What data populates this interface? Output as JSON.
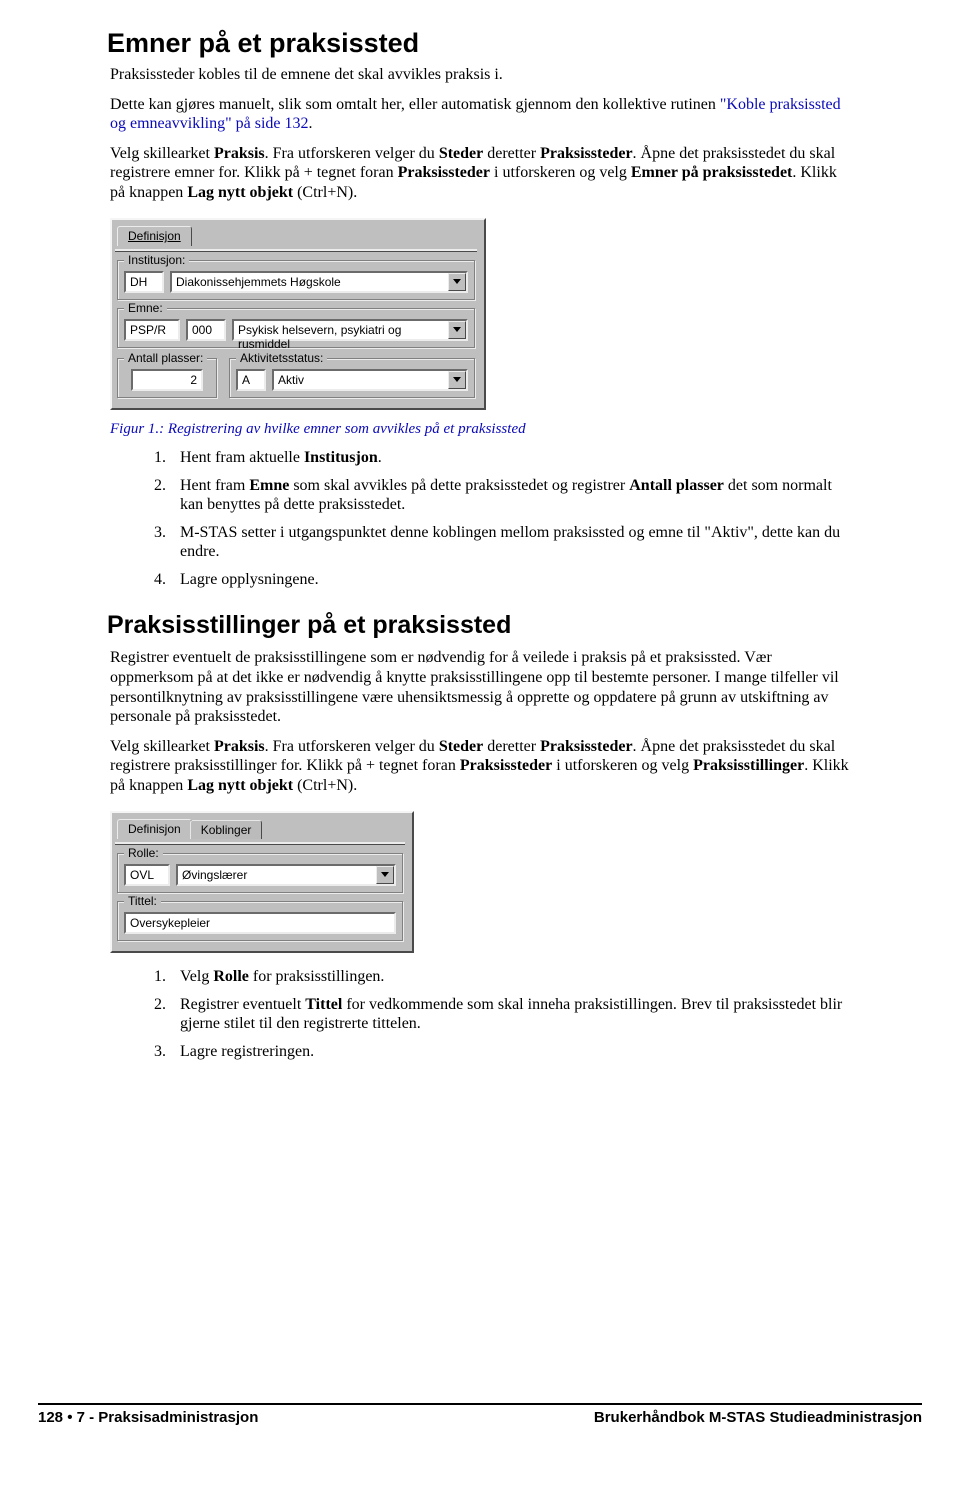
{
  "h1": "Emner på et praksissted",
  "p1_a": "Praksissteder kobles til de emnene det skal avvikles praksis i.",
  "p1_b_pre": "Dette kan gjøres manuelt, slik som omtalt her, eller automatisk gjennom den kollektive rutinen ",
  "p1_b_link": "\"Koble praksissted og emneavvikling\" på side 132",
  "p1_b_post": ".",
  "p2": "Velg skillearket Praksis. Fra utforskeren velger du Steder deretter Praksissteder. Åpne det praksisstedet du skal registrere emner for. Klikk på + tegnet foran Praksissteder i utforskeren og velg  Emner på praksisstedet. Klikk på knappen Lag nytt objekt (Ctrl+N).",
  "fig1": {
    "tab_def": "Definisjon",
    "grp_inst": "Institusjon:",
    "inst_code": "DH",
    "inst_name": "Diakonissehjemmets Høgskole",
    "grp_emne": "Emne:",
    "emne_c1": "PSP/R",
    "emne_c2": "000",
    "emne_name": "Psykisk helsevern, psykiatri og rusmiddel",
    "grp_antall": "Antall plasser:",
    "antall_val": "2",
    "grp_status": "Aktivitetsstatus:",
    "status_c": "A",
    "status_name": "Aktiv"
  },
  "caption1": "Figur 1.: Registrering av hvilke emner som avvikles på et praksissted",
  "steps1": [
    "Hent fram aktuelle Institusjon.",
    "Hent fram Emne som skal avvikles på dette praksisstedet og registrer Antall plasser det som normalt kan benyttes på dette praksisstedet.",
    "M-STAS setter i utgangspunktet denne koblingen mellom praksissted og emne til \"Aktiv\", dette kan du endre.",
    "Lagre opplysningene."
  ],
  "h2": "Praksisstillinger på et praksissted",
  "p3": "Registrer eventuelt de praksisstillingene som er nødvendig for å veilede i praksis på et praksissted. Vær oppmerksom på at det ikke er nødvendig å knytte praksisstillingene opp til bestemte personer. I mange tilfeller vil persontilknytning av praksisstillingene være uhensiktsmessig å opprette og oppdatere på grunn av utskiftning av personale på praksisstedet.",
  "p4": "Velg skillearket Praksis. Fra utforskeren velger du Steder deretter Praksissteder. Åpne det praksisstedet du skal registrere praksisstillinger for. Klikk på + tegnet foran Praksissteder i utforskeren og velg  Praksisstillinger. Klikk på knappen Lag nytt objekt (Ctrl+N).",
  "fig2": {
    "tab_def": "Definisjon",
    "tab_kob": "Koblinger",
    "grp_rolle": "Rolle:",
    "rolle_code": "OVL",
    "rolle_name": "Øvingslærer",
    "grp_tittel": "Tittel:",
    "tittel_val": "Oversykepleier"
  },
  "steps2": [
    "Velg Rolle for praksisstillingen.",
    "Registrer eventuelt Tittel for vedkommende som skal inneha praksistillingen. Brev til praksisstedet blir gjerne stilet til den registrerte tittelen.",
    "Lagre registreringen."
  ],
  "footer_left": "128 • 7 - Praksisadministrasjon",
  "footer_right": "Brukerhåndbok M-STAS Studieadministrasjon"
}
